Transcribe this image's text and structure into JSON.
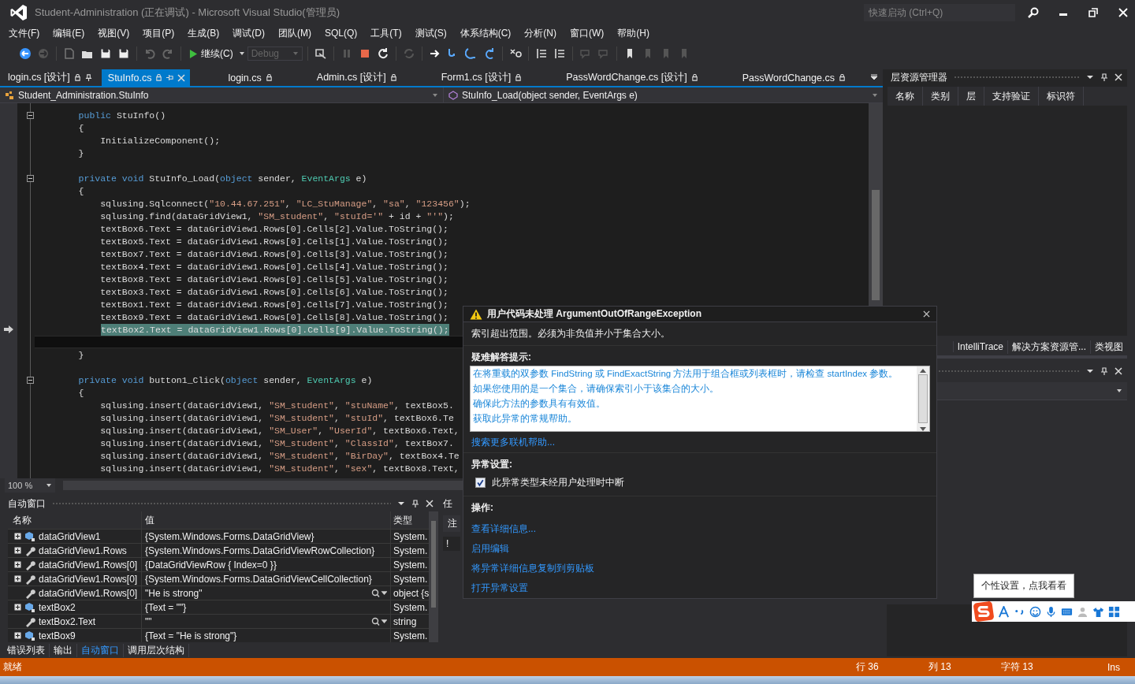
{
  "window": {
    "title": "Student-Administration (正在调试) - Microsoft Visual Studio(管理员)"
  },
  "quick_launch": {
    "placeholder": "快速启动 (Ctrl+Q)"
  },
  "menu": [
    "文件(F)",
    "编辑(E)",
    "视图(V)",
    "项目(P)",
    "生成(B)",
    "调试(D)",
    "团队(M)",
    "SQL(Q)",
    "工具(T)",
    "测试(S)",
    "体系结构(C)",
    "分析(N)",
    "窗口(W)",
    "帮助(H)"
  ],
  "toolbar": {
    "continue_button": "继续(C)",
    "configuration": {
      "value": "Debug",
      "disabled": true
    }
  },
  "document_tabs": [
    {
      "label": "login.cs [设计]",
      "selected": false,
      "pinned": true
    },
    {
      "label": "StuInfo.cs",
      "selected": true,
      "pinned": false
    },
    {
      "label": "login.cs",
      "selected": false,
      "pinned": false
    },
    {
      "label": "Admin.cs [设计]",
      "selected": false,
      "pinned": false
    },
    {
      "label": "Form1.cs [设计]",
      "selected": false,
      "pinned": false
    },
    {
      "label": "PassWordChange.cs [设计]",
      "selected": false,
      "pinned": false
    },
    {
      "label": "PassWordChange.cs",
      "selected": false,
      "pinned": false
    }
  ],
  "navigation": {
    "class": "Student_Administration.StuInfo",
    "member": "StuInfo_Load(object sender, EventArgs e)"
  },
  "editor": {
    "zoom": "100 %",
    "lines": [
      {
        "kind": "normal",
        "collapsible": true,
        "segments": [
          {
            "kind": "kw",
            "text": "    public"
          },
          {
            "kind": "text",
            "text": " StuInfo()"
          }
        ]
      },
      {
        "kind": "normal",
        "segments": [
          {
            "kind": "text",
            "text": "    {"
          }
        ]
      },
      {
        "kind": "normal",
        "segments": [
          {
            "kind": "text",
            "text": "        InitializeComponent();"
          }
        ]
      },
      {
        "kind": "normal",
        "segments": [
          {
            "kind": "text",
            "text": "    }"
          }
        ]
      },
      {
        "kind": "blank"
      },
      {
        "kind": "normal",
        "collapsible": true,
        "segments": [
          {
            "kind": "kw",
            "text": "    private void"
          },
          {
            "kind": "text",
            "text": " StuInfo_Load("
          },
          {
            "kind": "kw",
            "text": "object"
          },
          {
            "kind": "text",
            "text": " sender, "
          },
          {
            "kind": "type",
            "text": "EventArgs"
          },
          {
            "kind": "text",
            "text": " e)"
          }
        ]
      },
      {
        "kind": "normal",
        "segments": [
          {
            "kind": "text",
            "text": "    {"
          }
        ]
      },
      {
        "kind": "normal",
        "segments": [
          {
            "kind": "text",
            "text": "        sqlusing.Sqlconnect("
          },
          {
            "kind": "str",
            "text": "\"10.44.67.251\""
          },
          {
            "kind": "text",
            "text": ", "
          },
          {
            "kind": "str",
            "text": "\"LC_StuManage\""
          },
          {
            "kind": "text",
            "text": ", "
          },
          {
            "kind": "str",
            "text": "\"sa\""
          },
          {
            "kind": "text",
            "text": ", "
          },
          {
            "kind": "str",
            "text": "\"123456\""
          },
          {
            "kind": "text",
            "text": ");"
          }
        ]
      },
      {
        "kind": "normal",
        "segments": [
          {
            "kind": "text",
            "text": "        sqlusing.find(dataGridView1, "
          },
          {
            "kind": "str",
            "text": "\"SM_student\""
          },
          {
            "kind": "text",
            "text": ", "
          },
          {
            "kind": "str",
            "text": "\"stuId='\""
          },
          {
            "kind": "text",
            "text": " + id + "
          },
          {
            "kind": "str",
            "text": "\"'\""
          },
          {
            "kind": "text",
            "text": ");"
          }
        ]
      },
      {
        "kind": "normal",
        "segments": [
          {
            "kind": "text",
            "text": "        textBox6.Text = dataGridView1.Rows[0].Cells[2].Value.ToString();"
          }
        ]
      },
      {
        "kind": "normal",
        "segments": [
          {
            "kind": "text",
            "text": "        textBox5.Text = dataGridView1.Rows[0].Cells[1].Value.ToString();"
          }
        ]
      },
      {
        "kind": "normal",
        "segments": [
          {
            "kind": "text",
            "text": "        textBox7.Text = dataGridView1.Rows[0].Cells[3].Value.ToString();"
          }
        ]
      },
      {
        "kind": "normal",
        "segments": [
          {
            "kind": "text",
            "text": "        textBox4.Text = dataGridView1.Rows[0].Cells[4].Value.ToString();"
          }
        ]
      },
      {
        "kind": "normal",
        "segments": [
          {
            "kind": "text",
            "text": "        textBox8.Text = dataGridView1.Rows[0].Cells[5].Value.ToString();"
          }
        ]
      },
      {
        "kind": "normal",
        "segments": [
          {
            "kind": "text",
            "text": "        textBox3.Text = dataGridView1.Rows[0].Cells[6].Value.ToString();"
          }
        ]
      },
      {
        "kind": "normal",
        "segments": [
          {
            "kind": "text",
            "text": "        textBox1.Text = dataGridView1.Rows[0].Cells[7].Value.ToString();"
          }
        ]
      },
      {
        "kind": "normal",
        "segments": [
          {
            "kind": "text",
            "text": "        textBox9.Text = dataGridView1.Rows[0].Cells[8].Value.ToString();"
          }
        ]
      },
      {
        "kind": "highlighted",
        "segments": [
          {
            "kind": "text",
            "text": "textBox2.Text = dataGridView1.Rows[0].Cells[9].Value.ToString();"
          }
        ]
      },
      {
        "kind": "current"
      },
      {
        "kind": "normal",
        "segments": [
          {
            "kind": "text",
            "text": "    }"
          }
        ]
      },
      {
        "kind": "blank"
      },
      {
        "kind": "normal",
        "collapsible": true,
        "segments": [
          {
            "kind": "kw",
            "text": "    private void"
          },
          {
            "kind": "text",
            "text": " button1_Click("
          },
          {
            "kind": "kw",
            "text": "object"
          },
          {
            "kind": "text",
            "text": " sender, "
          },
          {
            "kind": "type",
            "text": "EventArgs"
          },
          {
            "kind": "text",
            "text": " e)"
          }
        ]
      },
      {
        "kind": "normal",
        "segments": [
          {
            "kind": "text",
            "text": "    {"
          }
        ]
      },
      {
        "kind": "normal",
        "segments": [
          {
            "kind": "text",
            "text": "        sqlusing.insert(dataGridView1, "
          },
          {
            "kind": "str",
            "text": "\"SM_student\""
          },
          {
            "kind": "text",
            "text": ", "
          },
          {
            "kind": "str",
            "text": "\"stuName\""
          },
          {
            "kind": "text",
            "text": ", textBox5."
          }
        ]
      },
      {
        "kind": "normal",
        "segments": [
          {
            "kind": "text",
            "text": "        sqlusing.insert(dataGridView1, "
          },
          {
            "kind": "str",
            "text": "\"SM_student\""
          },
          {
            "kind": "text",
            "text": ", "
          },
          {
            "kind": "str",
            "text": "\"stuId\""
          },
          {
            "kind": "text",
            "text": ", textBox6.Te"
          }
        ]
      },
      {
        "kind": "normal",
        "segments": [
          {
            "kind": "text",
            "text": "        sqlusing.insert(dataGridView1, "
          },
          {
            "kind": "str",
            "text": "\"SM_User\""
          },
          {
            "kind": "text",
            "text": ", "
          },
          {
            "kind": "str",
            "text": "\"UserId\""
          },
          {
            "kind": "text",
            "text": ", textBox6.Text,"
          }
        ]
      },
      {
        "kind": "normal",
        "segments": [
          {
            "kind": "text",
            "text": "        sqlusing.insert(dataGridView1, "
          },
          {
            "kind": "str",
            "text": "\"SM_student\""
          },
          {
            "kind": "text",
            "text": ", "
          },
          {
            "kind": "str",
            "text": "\"ClassId\""
          },
          {
            "kind": "text",
            "text": ", textBox7."
          }
        ]
      },
      {
        "kind": "normal",
        "segments": [
          {
            "kind": "text",
            "text": "        sqlusing.insert(dataGridView1, "
          },
          {
            "kind": "str",
            "text": "\"SM_student\""
          },
          {
            "kind": "text",
            "text": ", "
          },
          {
            "kind": "str",
            "text": "\"BirDay\""
          },
          {
            "kind": "text",
            "text": ", textBox4.Te"
          }
        ]
      },
      {
        "kind": "normal",
        "segments": [
          {
            "kind": "text",
            "text": "        sqlusing.insert(dataGridView1, "
          },
          {
            "kind": "str",
            "text": "\"SM_student\""
          },
          {
            "kind": "text",
            "text": ", "
          },
          {
            "kind": "str",
            "text": "\"sex\""
          },
          {
            "kind": "text",
            "text": ", textBox8.Text,"
          }
        ]
      }
    ]
  },
  "autos": {
    "title": "自动窗口",
    "columns": [
      "名称",
      "值",
      "类型"
    ],
    "rows": [
      {
        "name": "dataGridView1",
        "value": "{System.Windows.Forms.DataGridView}",
        "type": "System.",
        "expandable": true,
        "kind": "field",
        "visualizer": false
      },
      {
        "name": "dataGridView1.Rows",
        "value": "{System.Windows.Forms.DataGridViewRowCollection}",
        "type": "System.",
        "expandable": true,
        "kind": "property",
        "visualizer": false
      },
      {
        "name": "dataGridView1.Rows[0]",
        "value": "{DataGridViewRow { Index=0 }}",
        "type": "System.",
        "expandable": true,
        "kind": "property",
        "visualizer": false
      },
      {
        "name": "dataGridView1.Rows[0]",
        "value": "{System.Windows.Forms.DataGridViewCellCollection}",
        "type": "System.",
        "expandable": true,
        "kind": "property",
        "visualizer": false
      },
      {
        "name": "dataGridView1.Rows[0]",
        "value": "\"He is strong\"",
        "type": "object {s",
        "expandable": false,
        "kind": "property",
        "visualizer": true
      },
      {
        "name": "textBox2",
        "value": "{Text = \"\"}",
        "type": "System.",
        "expandable": true,
        "kind": "field",
        "visualizer": false
      },
      {
        "name": "textBox2.Text",
        "value": "\"\"",
        "type": "string",
        "expandable": false,
        "kind": "property",
        "visualizer": true
      },
      {
        "name": "textBox9",
        "value": "{Text = \"He is strong\"}",
        "type": "System.",
        "expandable": true,
        "kind": "field",
        "visualizer": false
      }
    ]
  },
  "bottom_tabs": [
    {
      "label": "错误列表",
      "selected": false
    },
    {
      "label": "输出",
      "selected": false
    },
    {
      "label": "自动窗口",
      "selected": true
    },
    {
      "label": "调用层次结构",
      "selected": false
    }
  ],
  "task_panel": {
    "title": "任",
    "column_1": "注",
    "column_2": "!"
  },
  "layer_explorer": {
    "title": "层资源管理器",
    "columns": [
      "名称",
      "类别",
      "层",
      "支持验证",
      "标识符"
    ]
  },
  "right_tabs": [
    {
      "label": "IntelliTrace",
      "selected": false
    },
    {
      "label": "解决方案资源管...",
      "selected": false
    },
    {
      "label": "类视图",
      "selected": false
    }
  ],
  "exception_popup": {
    "title": "用户代码未处理 ArgumentOutOfRangeException",
    "message": "索引超出范围。必须为非负值并小于集合大小。",
    "tips_heading": "疑难解答提示:",
    "tips": [
      "在将重载的双参数 FindString 或 FindExactString 方法用于组合框或列表框时，请检查 startIndex 参数。",
      "如果您使用的是一个集合，请确保索引小于该集合的大小。",
      "确保此方法的参数具有有效值。",
      "获取此异常的常规帮助。"
    ],
    "search_link": "搜索更多联机帮助...",
    "settings_heading": "异常设置:",
    "break_option": {
      "label": "此异常类型未经用户处理时中断",
      "checked": true
    },
    "actions_heading": "操作:",
    "actions": [
      "查看详细信息...",
      "启用编辑",
      "将异常详细信息复制到剪贴板",
      "打开异常设置"
    ]
  },
  "ime": {
    "tooltip": "个性设置，点我看看"
  },
  "status_bar": {
    "message": "就绪",
    "line": "行 36",
    "column": "列 13",
    "char": "字符 13",
    "mode": "Ins"
  }
}
